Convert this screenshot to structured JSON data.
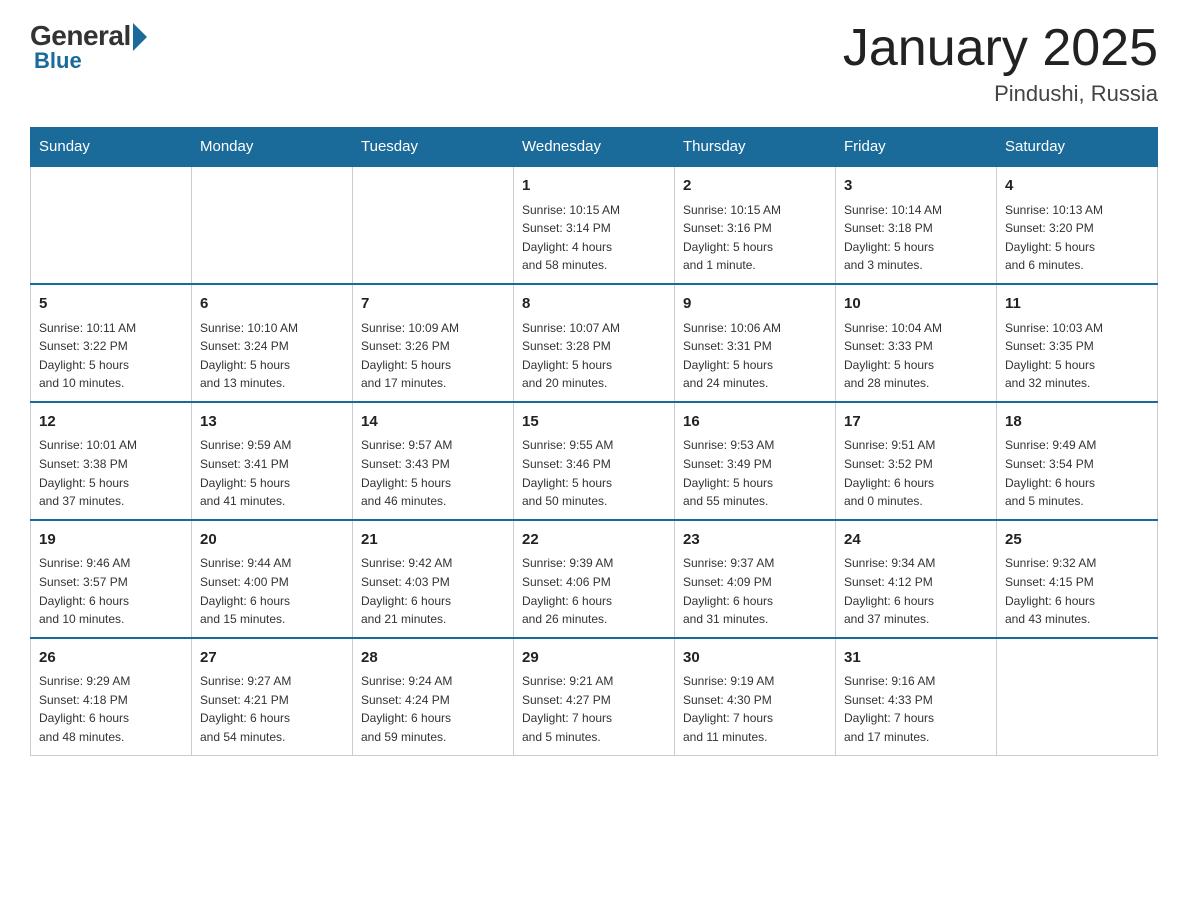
{
  "header": {
    "logo_general": "General",
    "logo_blue": "Blue",
    "month_year": "January 2025",
    "location": "Pindushi, Russia"
  },
  "days_of_week": [
    "Sunday",
    "Monday",
    "Tuesday",
    "Wednesday",
    "Thursday",
    "Friday",
    "Saturday"
  ],
  "weeks": [
    [
      {
        "day": "",
        "info": ""
      },
      {
        "day": "",
        "info": ""
      },
      {
        "day": "",
        "info": ""
      },
      {
        "day": "1",
        "info": "Sunrise: 10:15 AM\nSunset: 3:14 PM\nDaylight: 4 hours\nand 58 minutes."
      },
      {
        "day": "2",
        "info": "Sunrise: 10:15 AM\nSunset: 3:16 PM\nDaylight: 5 hours\nand 1 minute."
      },
      {
        "day": "3",
        "info": "Sunrise: 10:14 AM\nSunset: 3:18 PM\nDaylight: 5 hours\nand 3 minutes."
      },
      {
        "day": "4",
        "info": "Sunrise: 10:13 AM\nSunset: 3:20 PM\nDaylight: 5 hours\nand 6 minutes."
      }
    ],
    [
      {
        "day": "5",
        "info": "Sunrise: 10:11 AM\nSunset: 3:22 PM\nDaylight: 5 hours\nand 10 minutes."
      },
      {
        "day": "6",
        "info": "Sunrise: 10:10 AM\nSunset: 3:24 PM\nDaylight: 5 hours\nand 13 minutes."
      },
      {
        "day": "7",
        "info": "Sunrise: 10:09 AM\nSunset: 3:26 PM\nDaylight: 5 hours\nand 17 minutes."
      },
      {
        "day": "8",
        "info": "Sunrise: 10:07 AM\nSunset: 3:28 PM\nDaylight: 5 hours\nand 20 minutes."
      },
      {
        "day": "9",
        "info": "Sunrise: 10:06 AM\nSunset: 3:31 PM\nDaylight: 5 hours\nand 24 minutes."
      },
      {
        "day": "10",
        "info": "Sunrise: 10:04 AM\nSunset: 3:33 PM\nDaylight: 5 hours\nand 28 minutes."
      },
      {
        "day": "11",
        "info": "Sunrise: 10:03 AM\nSunset: 3:35 PM\nDaylight: 5 hours\nand 32 minutes."
      }
    ],
    [
      {
        "day": "12",
        "info": "Sunrise: 10:01 AM\nSunset: 3:38 PM\nDaylight: 5 hours\nand 37 minutes."
      },
      {
        "day": "13",
        "info": "Sunrise: 9:59 AM\nSunset: 3:41 PM\nDaylight: 5 hours\nand 41 minutes."
      },
      {
        "day": "14",
        "info": "Sunrise: 9:57 AM\nSunset: 3:43 PM\nDaylight: 5 hours\nand 46 minutes."
      },
      {
        "day": "15",
        "info": "Sunrise: 9:55 AM\nSunset: 3:46 PM\nDaylight: 5 hours\nand 50 minutes."
      },
      {
        "day": "16",
        "info": "Sunrise: 9:53 AM\nSunset: 3:49 PM\nDaylight: 5 hours\nand 55 minutes."
      },
      {
        "day": "17",
        "info": "Sunrise: 9:51 AM\nSunset: 3:52 PM\nDaylight: 6 hours\nand 0 minutes."
      },
      {
        "day": "18",
        "info": "Sunrise: 9:49 AM\nSunset: 3:54 PM\nDaylight: 6 hours\nand 5 minutes."
      }
    ],
    [
      {
        "day": "19",
        "info": "Sunrise: 9:46 AM\nSunset: 3:57 PM\nDaylight: 6 hours\nand 10 minutes."
      },
      {
        "day": "20",
        "info": "Sunrise: 9:44 AM\nSunset: 4:00 PM\nDaylight: 6 hours\nand 15 minutes."
      },
      {
        "day": "21",
        "info": "Sunrise: 9:42 AM\nSunset: 4:03 PM\nDaylight: 6 hours\nand 21 minutes."
      },
      {
        "day": "22",
        "info": "Sunrise: 9:39 AM\nSunset: 4:06 PM\nDaylight: 6 hours\nand 26 minutes."
      },
      {
        "day": "23",
        "info": "Sunrise: 9:37 AM\nSunset: 4:09 PM\nDaylight: 6 hours\nand 31 minutes."
      },
      {
        "day": "24",
        "info": "Sunrise: 9:34 AM\nSunset: 4:12 PM\nDaylight: 6 hours\nand 37 minutes."
      },
      {
        "day": "25",
        "info": "Sunrise: 9:32 AM\nSunset: 4:15 PM\nDaylight: 6 hours\nand 43 minutes."
      }
    ],
    [
      {
        "day": "26",
        "info": "Sunrise: 9:29 AM\nSunset: 4:18 PM\nDaylight: 6 hours\nand 48 minutes."
      },
      {
        "day": "27",
        "info": "Sunrise: 9:27 AM\nSunset: 4:21 PM\nDaylight: 6 hours\nand 54 minutes."
      },
      {
        "day": "28",
        "info": "Sunrise: 9:24 AM\nSunset: 4:24 PM\nDaylight: 6 hours\nand 59 minutes."
      },
      {
        "day": "29",
        "info": "Sunrise: 9:21 AM\nSunset: 4:27 PM\nDaylight: 7 hours\nand 5 minutes."
      },
      {
        "day": "30",
        "info": "Sunrise: 9:19 AM\nSunset: 4:30 PM\nDaylight: 7 hours\nand 11 minutes."
      },
      {
        "day": "31",
        "info": "Sunrise: 9:16 AM\nSunset: 4:33 PM\nDaylight: 7 hours\nand 17 minutes."
      },
      {
        "day": "",
        "info": ""
      }
    ]
  ]
}
